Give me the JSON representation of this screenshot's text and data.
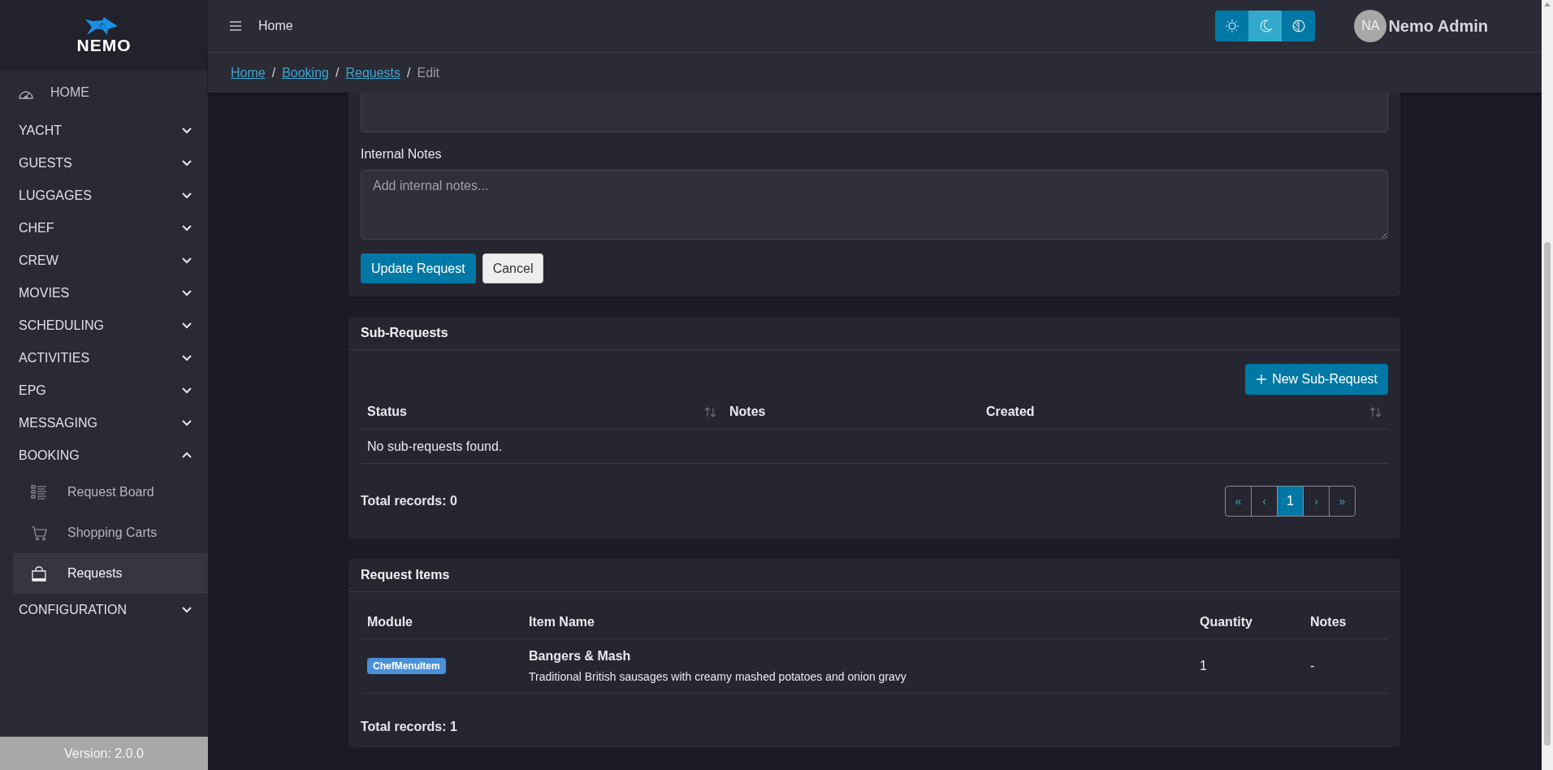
{
  "sidebar": {
    "logo_text": "NEMO",
    "home": "HOME",
    "items": [
      {
        "label": "YACHT",
        "expanded": false
      },
      {
        "label": "GUESTS",
        "expanded": false
      },
      {
        "label": "LUGGAGES",
        "expanded": false
      },
      {
        "label": "CHEF",
        "expanded": false
      },
      {
        "label": "CREW",
        "expanded": false
      },
      {
        "label": "MOVIES",
        "expanded": false
      },
      {
        "label": "SCHEDULING",
        "expanded": false
      },
      {
        "label": "ACTIVITIES",
        "expanded": false
      },
      {
        "label": "EPG",
        "expanded": false
      },
      {
        "label": "MESSAGING",
        "expanded": false
      },
      {
        "label": "BOOKING",
        "expanded": true,
        "children": [
          {
            "label": "Request Board",
            "kind": "list",
            "selected": false
          },
          {
            "label": "Shopping Carts",
            "kind": "cart",
            "selected": false
          },
          {
            "label": "Requests",
            "kind": "bag",
            "selected": true
          }
        ]
      },
      {
        "label": "CONFIGURATION",
        "expanded": false
      }
    ],
    "version": "Version: 2.0.0"
  },
  "topbar": {
    "title": "Home",
    "theme_buttons": [
      {
        "kind": "light",
        "selected": false
      },
      {
        "kind": "dark",
        "selected": true
      },
      {
        "kind": "contrast",
        "selected": false
      }
    ],
    "user": {
      "initials": "NA",
      "name": "Nemo Admin"
    }
  },
  "breadcrumb": [
    {
      "label": "Home",
      "link": true
    },
    {
      "separator": "/",
      "label": "Booking",
      "link": true
    },
    {
      "separator": "/",
      "label": "Requests",
      "link": true
    },
    {
      "separator": "/",
      "label": "Edit",
      "link": false
    }
  ],
  "request_form": {
    "internal_notes": {
      "label": "Internal Notes",
      "placeholder": "Add internal notes..."
    },
    "buttons": [
      {
        "label": "Update Request",
        "kind": "primary"
      },
      {
        "label": "Cancel",
        "kind": "secondary"
      }
    ]
  },
  "sub_requests": {
    "title": "Sub-Requests",
    "new_button": "New Sub-Request",
    "columns": [
      {
        "label": "Status",
        "sortable": true
      },
      {
        "label": "Notes",
        "sortable": false
      },
      {
        "label": "Created",
        "sortable": true
      }
    ],
    "empty": "No sub-requests found.",
    "total": "Total records: 0",
    "pager": [
      {
        "label": "«",
        "selected": false
      },
      {
        "label": "‹",
        "selected": false
      },
      {
        "label": "1",
        "selected": true
      },
      {
        "label": "›",
        "selected": false
      },
      {
        "label": "»",
        "selected": false
      }
    ]
  },
  "request_items": {
    "title": "Request Items",
    "columns": [
      "Module",
      "Item Name",
      "Quantity",
      "Notes"
    ],
    "rows": [
      {
        "module": "ChefMenuItem",
        "name": "Bangers & Mash",
        "description": "Traditional British sausages with creamy mashed potatoes and onion gravy",
        "quantity": "1",
        "notes": "-"
      }
    ],
    "total": "Total records: 1"
  }
}
